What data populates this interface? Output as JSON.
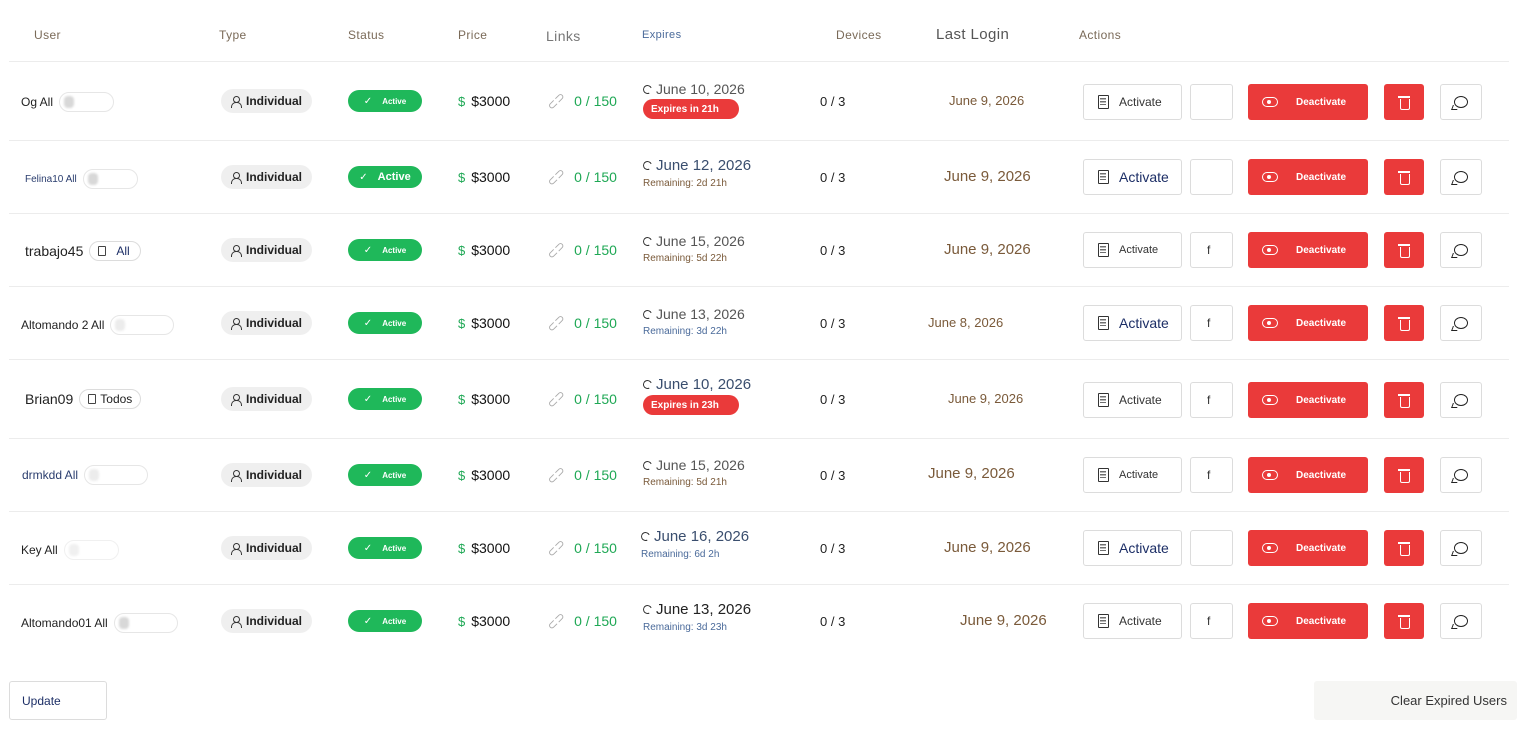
{
  "headers": {
    "user": "User",
    "type": "Type",
    "status": "Status",
    "price": "Price",
    "links": "Links",
    "expires": "Expires",
    "devices": "Devices",
    "last_login": "Last Login",
    "actions": "Actions"
  },
  "rows": [
    {
      "username": "Og All",
      "tag": "",
      "type": "Individual",
      "status": "Active",
      "price": "$3000",
      "links": "0 / 150",
      "expires_date": "June 10, 2026",
      "expires_note": "Expires in 21h",
      "devices": "0 / 3",
      "last_login": "June 9, 2026",
      "activate_label": "Activate",
      "f_label": "",
      "deactivate_label": "Deactivate"
    },
    {
      "username": "Felina10 All",
      "tag": "",
      "type": "Individual",
      "status": "Active",
      "price": "$3000",
      "links": "0 / 150",
      "expires_date": "June 12, 2026",
      "expires_note": "Remaining: 2d 21h",
      "devices": "0 / 3",
      "last_login": "June 9, 2026",
      "activate_label": "Activate",
      "f_label": "",
      "deactivate_label": "Deactivate"
    },
    {
      "username": "trabajo45",
      "tag": "All",
      "type": "Individual",
      "status": "Active",
      "price": "$3000",
      "links": "0 / 150",
      "expires_date": "June 15, 2026",
      "expires_note": "Remaining: 5d 22h",
      "devices": "0 / 3",
      "last_login": "June 9, 2026",
      "activate_label": "Activate",
      "f_label": "f",
      "deactivate_label": "Deactivate"
    },
    {
      "username": "Altomando 2 All",
      "tag": "",
      "type": "Individual",
      "status": "Active",
      "price": "$3000",
      "links": "0 / 150",
      "expires_date": "June 13, 2026",
      "expires_note": "Remaining: 3d 22h",
      "devices": "0 / 3",
      "last_login": "June 8, 2026",
      "activate_label": "Activate",
      "f_label": "f",
      "deactivate_label": "Deactivate"
    },
    {
      "username": "Brian09",
      "tag": "Todos",
      "type": "Individual",
      "status": "Active",
      "price": "$3000",
      "links": "0 / 150",
      "expires_date": "June 10, 2026",
      "expires_note": "Expires in 23h",
      "devices": "0 / 3",
      "last_login": "June 9, 2026",
      "activate_label": "Activate",
      "f_label": "f",
      "deactivate_label": "Deactivate"
    },
    {
      "username": "drmkdd All",
      "tag": "",
      "type": "Individual",
      "status": "Active",
      "price": "$3000",
      "links": "0 / 150",
      "expires_date": "June 15, 2026",
      "expires_note": "Remaining: 5d 21h",
      "devices": "0 / 3",
      "last_login": "June 9, 2026",
      "activate_label": "Activate",
      "f_label": "f",
      "deactivate_label": "Deactivate"
    },
    {
      "username": "Key All",
      "tag": "",
      "type": "Individual",
      "status": "Active",
      "price": "$3000",
      "links": "0 / 150",
      "expires_date": "June 16, 2026",
      "expires_note": "Remaining: 6d 2h",
      "devices": "0 / 3",
      "last_login": "June 9, 2026",
      "activate_label": "Activate",
      "f_label": "",
      "deactivate_label": "Deactivate"
    },
    {
      "username": "Altomando01 All",
      "tag": "",
      "type": "Individual",
      "status": "Active",
      "price": "$3000",
      "links": "0 / 150",
      "expires_date": "June 13, 2026",
      "expires_note": "Remaining: 3d 23h",
      "devices": "0 / 3",
      "last_login": "June 9, 2026",
      "activate_label": "Activate",
      "f_label": "f",
      "deactivate_label": "Deactivate"
    }
  ],
  "footer": {
    "update_label": "Update",
    "clear_label": "Clear Expired Users"
  },
  "colors": {
    "active_green": "#1fb85a",
    "danger_red": "#ea3a3a",
    "link_green": "#1fa855"
  }
}
